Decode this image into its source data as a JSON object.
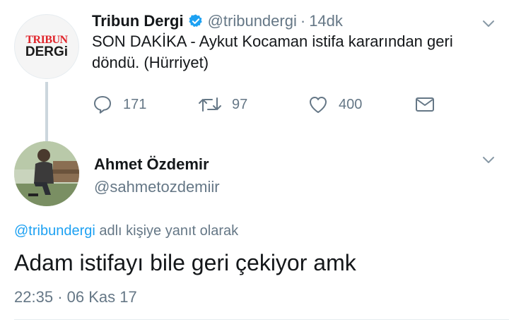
{
  "tweet1": {
    "avatar_logo_top": "TRIBUN",
    "avatar_logo_bottom": "DERGi",
    "name": "Tribun Dergi",
    "handle": "@tribundergi",
    "separator": "·",
    "time": "14dk",
    "text": "SON DAKİKA - Aykut Kocaman istifa kararından geri döndü. (Hürriyet)",
    "replies": "171",
    "retweets": "97",
    "likes": "400"
  },
  "tweet2": {
    "name": "Ahmet Özdemir",
    "handle": "@sahmetozdemiir",
    "reply_to_handle": "@tribundergi",
    "reply_to_suffix": " adlı kişiye yanıt olarak",
    "text": "Adam istifayı bile geri çekiyor amk",
    "time": "22:35",
    "separator": "·",
    "date": "06 Kas 17"
  },
  "icons": {
    "verified": "verified-badge-icon",
    "caret": "chevron-down-icon",
    "reply": "reply-icon",
    "retweet": "retweet-icon",
    "like": "heart-icon",
    "dm": "envelope-icon"
  },
  "colors": {
    "text": "#14171a",
    "secondary": "#657786",
    "link": "#1da1f2",
    "verified": "#1da1f2",
    "thread_line": "#ccd6dd",
    "logo_red": "#e0242a"
  }
}
